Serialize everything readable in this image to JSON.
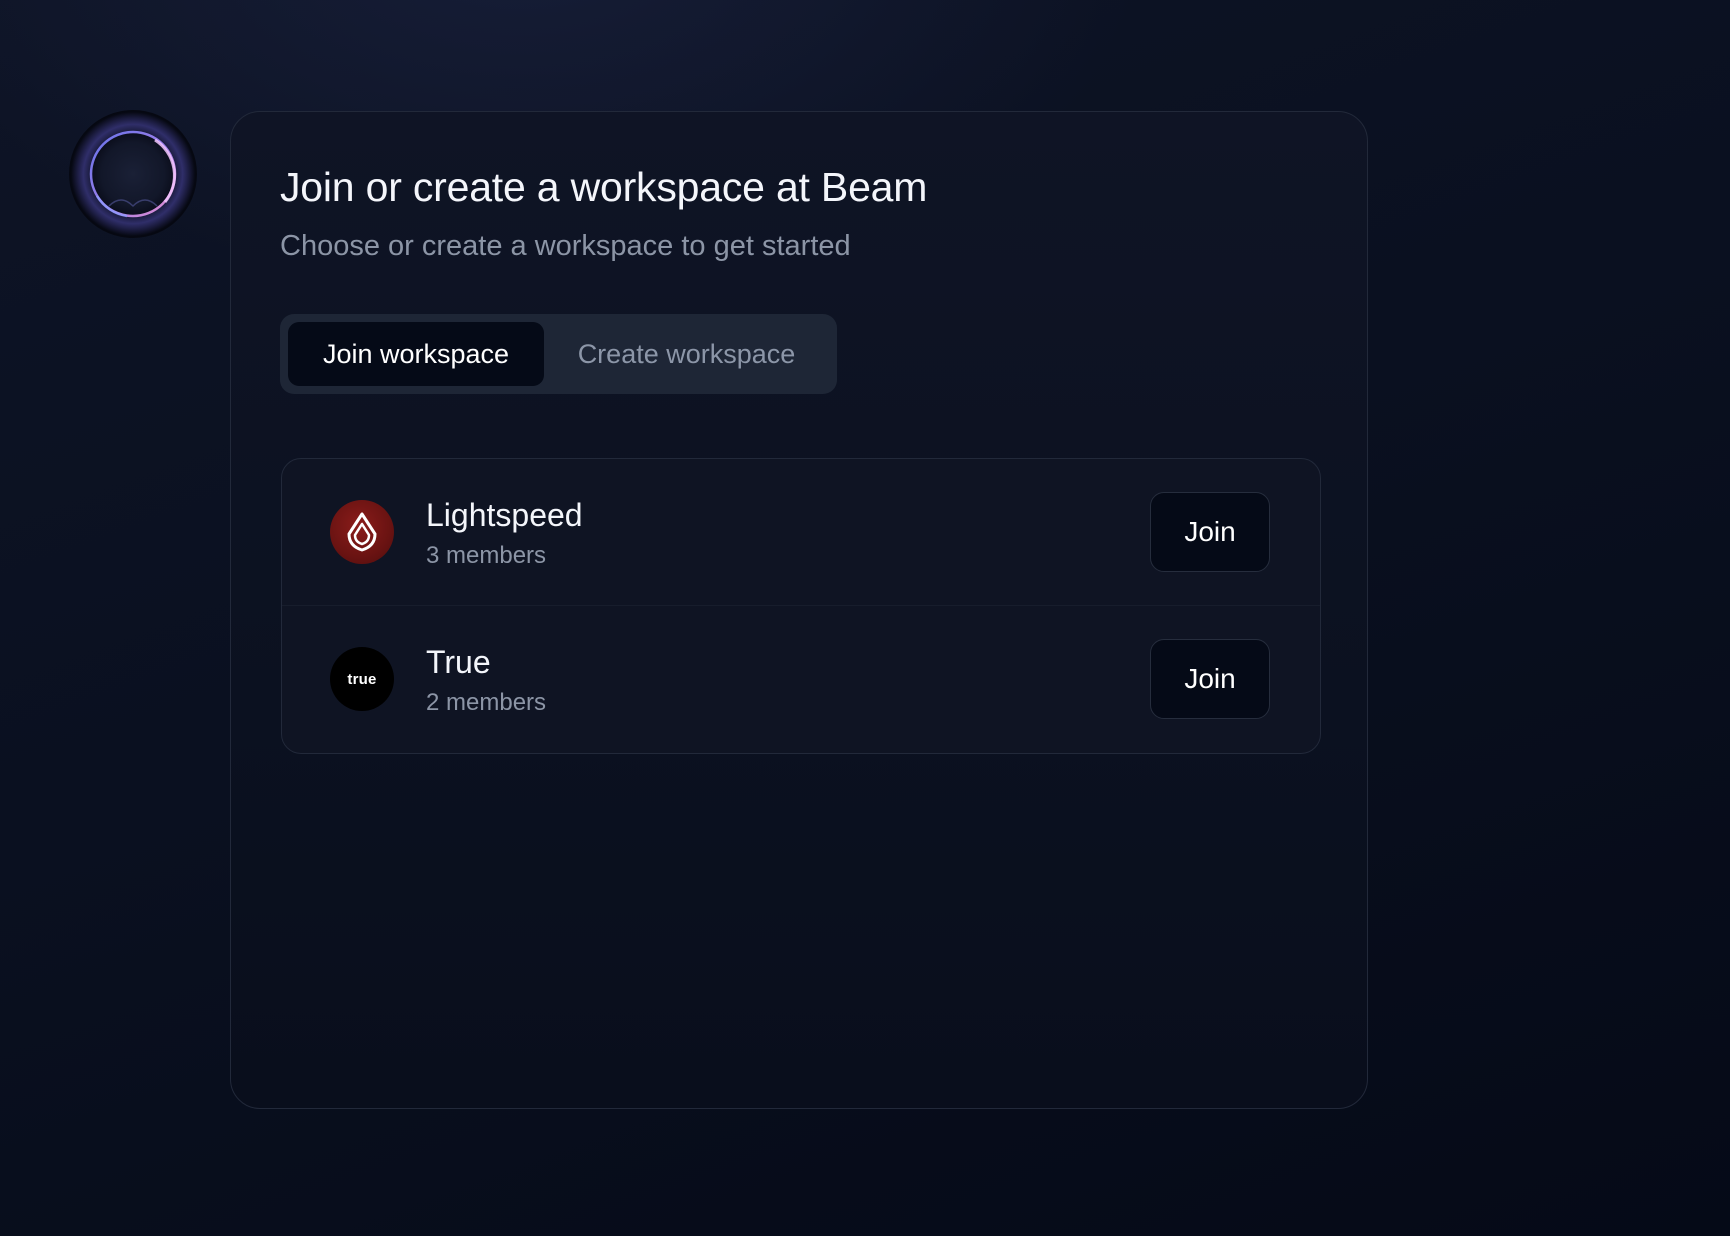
{
  "app": {
    "logo_icon": "beam-orb-icon"
  },
  "card": {
    "title": "Join or create a workspace at Beam",
    "subtitle": "Choose or create a workspace to get started"
  },
  "tabs": [
    {
      "label": "Join workspace",
      "active": true
    },
    {
      "label": "Create workspace",
      "active": false
    }
  ],
  "workspaces": [
    {
      "name": "Lightspeed",
      "members": "3 members",
      "logo_icon": "lightspeed-flame-icon",
      "logo_color": "#7a1715",
      "join_label": "Join"
    },
    {
      "name": "True",
      "members": "2 members",
      "logo_icon": "true-wordmark-icon",
      "logo_text": "true",
      "logo_color": "#000000",
      "join_label": "Join"
    }
  ],
  "colors": {
    "background": "#0a1020",
    "card_border": "#22293a",
    "muted_text": "#8c95a6",
    "tab_track": "#1e2636",
    "button_bg": "#050a17"
  }
}
